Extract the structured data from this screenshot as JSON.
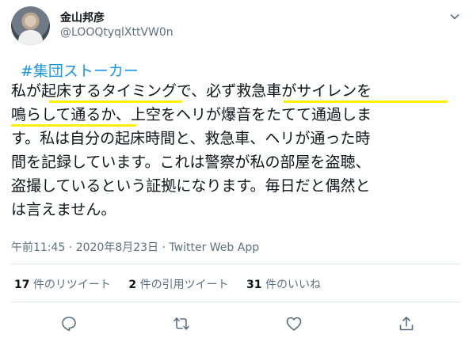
{
  "tweet": {
    "author_name": "金山邦彦",
    "author_handle": "@LOOQtyqlXttVW0n",
    "hashtag": "#集団ストーカー",
    "lines": [
      "私が起床するタイミングで、必ず救急車がサイレンを",
      "鳴らして通るか、上空をヘリが爆音をたてて通過しま",
      "す。私は自分の起床時間と、救急車、ヘリが通った時",
      "間を記録しています。これは警察が私の部屋を盗聴、",
      "盗撮しているという証拠になります。毎日だと偶然と",
      "は言えません。"
    ],
    "timestamp": "午前11:45 · 2020年8月23日 · Twitter Web App"
  },
  "stats": {
    "retweets_count": "17",
    "retweets_label": " 件のリツイート",
    "quotes_count": "2",
    "quotes_label": " 件の引用ツイート",
    "likes_count": "31",
    "likes_label": " 件のいいね"
  },
  "icons": [
    "chevron-down-icon",
    "reply-icon",
    "retweet-icon",
    "like-icon",
    "share-icon"
  ],
  "colors": {
    "link": "#1b95e0",
    "highlight": "#ffef00",
    "secondary": "#5b7083"
  }
}
